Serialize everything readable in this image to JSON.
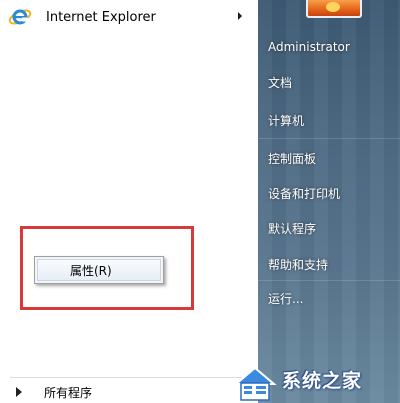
{
  "left_pane": {
    "pinned_item": {
      "label": "Internet Explorer",
      "icon": "internet-explorer-icon"
    },
    "all_programs_label": "所有程序"
  },
  "context_menu": {
    "items": [
      {
        "label": "属性(R)"
      }
    ]
  },
  "right_pane": {
    "user_name": "Administrator",
    "items": [
      {
        "label": "文档"
      },
      {
        "label": "计算机"
      },
      {
        "label": "控制面板"
      },
      {
        "label": "设备和打印机"
      },
      {
        "label": "默认程序"
      },
      {
        "label": "帮助和支持"
      },
      {
        "label": "运行..."
      }
    ]
  },
  "watermark": {
    "text": "系统之家"
  },
  "colors": {
    "highlight_border": "#d63a3a",
    "right_pane_bg": "#4e6b84",
    "menu_text_light": "#ffffff"
  }
}
